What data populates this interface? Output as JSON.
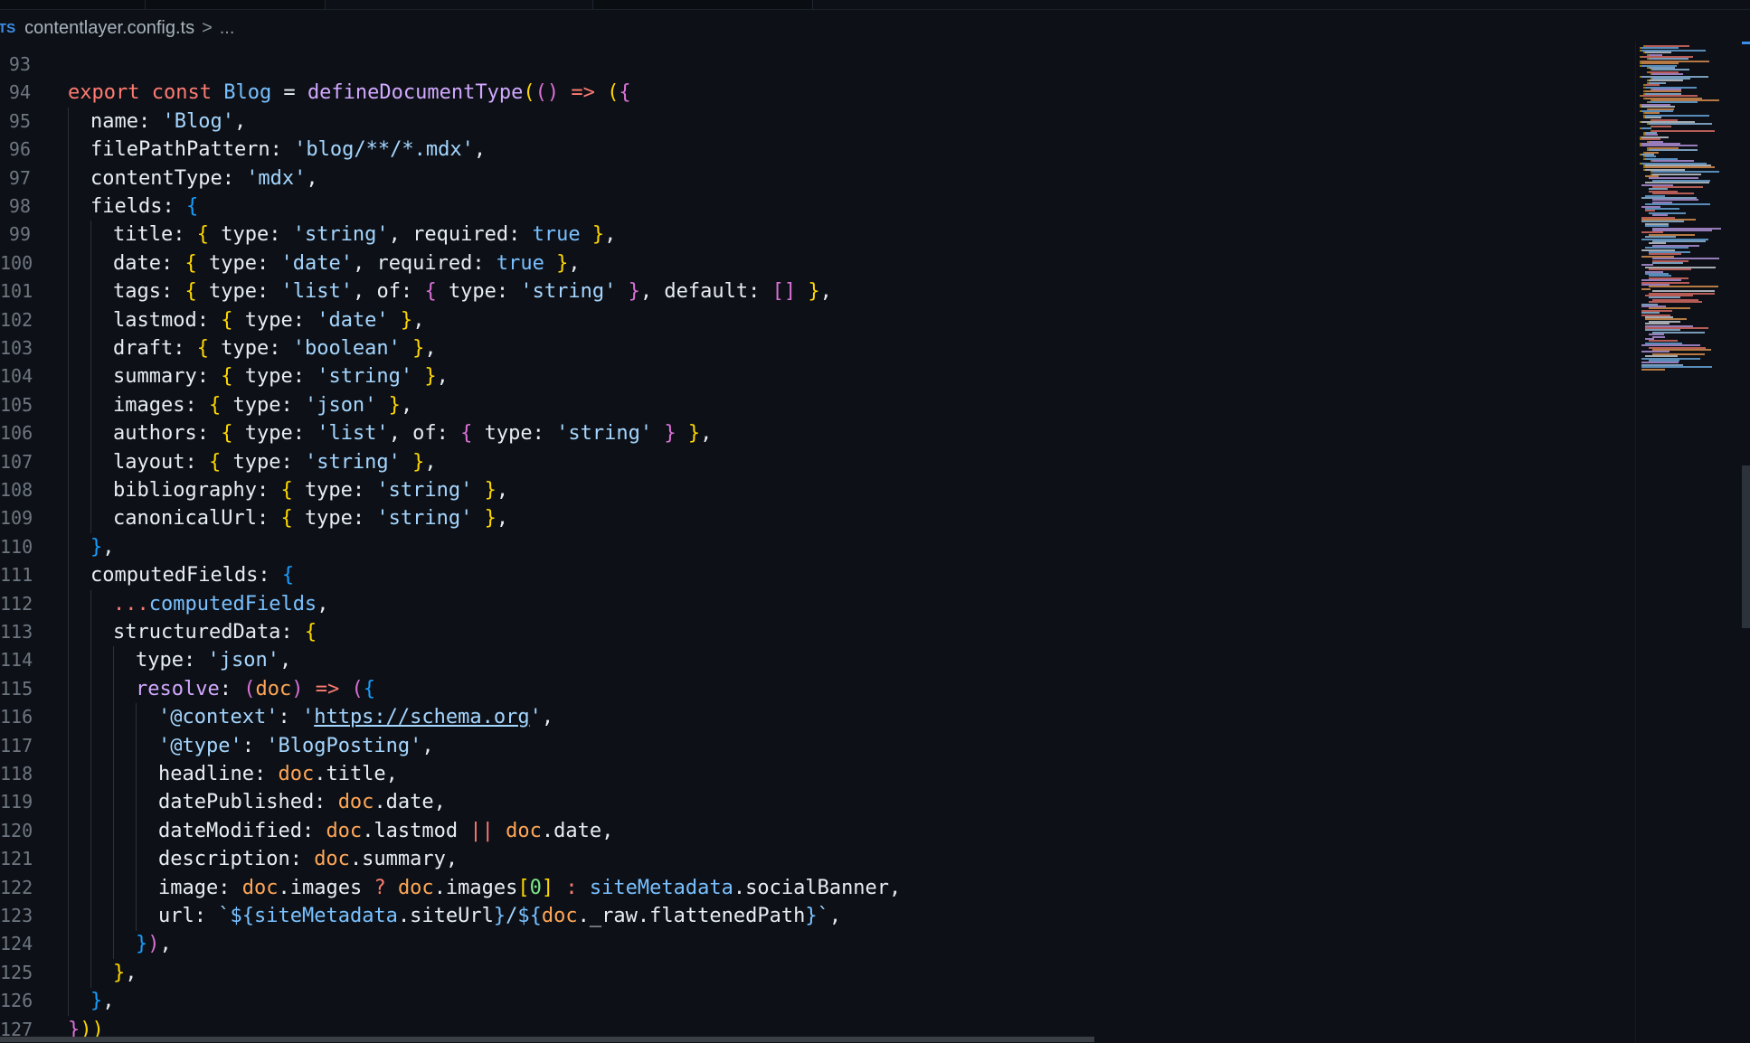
{
  "breadcrumb": {
    "lang_badge": "TS",
    "file": "contentlayer.config.ts",
    "separator": ">",
    "ellipsis": "..."
  },
  "editor": {
    "lines": [
      {
        "n": "93",
        "indent": 0,
        "tokens": []
      },
      {
        "n": "94",
        "indent": 0,
        "tokens": [
          [
            "kw",
            "export "
          ],
          [
            "kw",
            "const "
          ],
          [
            "var",
            "Blog"
          ],
          [
            "pl",
            " = "
          ],
          [
            "fn",
            "defineDocumentType"
          ],
          [
            "p1",
            "("
          ],
          [
            "p2",
            "()"
          ],
          [
            "pl",
            " "
          ],
          [
            "op",
            "=>"
          ],
          [
            "pl",
            " "
          ],
          [
            "p1",
            "("
          ],
          [
            "p2",
            "{"
          ]
        ]
      },
      {
        "n": "95",
        "indent": 1,
        "tokens": [
          [
            "pl",
            "name: "
          ],
          [
            "str",
            "'Blog'"
          ],
          [
            "pl",
            ","
          ]
        ]
      },
      {
        "n": "96",
        "indent": 1,
        "tokens": [
          [
            "pl",
            "filePathPattern: "
          ],
          [
            "str",
            "'blog/**/*.mdx'"
          ],
          [
            "pl",
            ","
          ]
        ]
      },
      {
        "n": "97",
        "indent": 1,
        "tokens": [
          [
            "pl",
            "contentType: "
          ],
          [
            "str",
            "'mdx'"
          ],
          [
            "pl",
            ","
          ]
        ]
      },
      {
        "n": "98",
        "indent": 1,
        "tokens": [
          [
            "pl",
            "fields: "
          ],
          [
            "p3",
            "{"
          ]
        ]
      },
      {
        "n": "99",
        "indent": 2,
        "tokens": [
          [
            "pl",
            "title: "
          ],
          [
            "p1",
            "{ "
          ],
          [
            "pl",
            "type: "
          ],
          [
            "str",
            "'string'"
          ],
          [
            "pl",
            ", required: "
          ],
          [
            "var",
            "true"
          ],
          [
            "p1",
            " }"
          ],
          [
            "pl",
            ","
          ]
        ]
      },
      {
        "n": "100",
        "indent": 2,
        "tokens": [
          [
            "pl",
            "date: "
          ],
          [
            "p1",
            "{ "
          ],
          [
            "pl",
            "type: "
          ],
          [
            "str",
            "'date'"
          ],
          [
            "pl",
            ", required: "
          ],
          [
            "var",
            "true"
          ],
          [
            "p1",
            " }"
          ],
          [
            "pl",
            ","
          ]
        ]
      },
      {
        "n": "101",
        "indent": 2,
        "tokens": [
          [
            "pl",
            "tags: "
          ],
          [
            "p1",
            "{ "
          ],
          [
            "pl",
            "type: "
          ],
          [
            "str",
            "'list'"
          ],
          [
            "pl",
            ", of: "
          ],
          [
            "p2",
            "{ "
          ],
          [
            "pl",
            "type: "
          ],
          [
            "str",
            "'string'"
          ],
          [
            "p2",
            " }"
          ],
          [
            "pl",
            ", default: "
          ],
          [
            "p2",
            "[]"
          ],
          [
            "p1",
            " }"
          ],
          [
            "pl",
            ","
          ]
        ]
      },
      {
        "n": "102",
        "indent": 2,
        "tokens": [
          [
            "pl",
            "lastmod: "
          ],
          [
            "p1",
            "{ "
          ],
          [
            "pl",
            "type: "
          ],
          [
            "str",
            "'date'"
          ],
          [
            "p1",
            " }"
          ],
          [
            "pl",
            ","
          ]
        ]
      },
      {
        "n": "103",
        "indent": 2,
        "tokens": [
          [
            "pl",
            "draft: "
          ],
          [
            "p1",
            "{ "
          ],
          [
            "pl",
            "type: "
          ],
          [
            "str",
            "'boolean'"
          ],
          [
            "p1",
            " }"
          ],
          [
            "pl",
            ","
          ]
        ]
      },
      {
        "n": "104",
        "indent": 2,
        "tokens": [
          [
            "pl",
            "summary: "
          ],
          [
            "p1",
            "{ "
          ],
          [
            "pl",
            "type: "
          ],
          [
            "str",
            "'string'"
          ],
          [
            "p1",
            " }"
          ],
          [
            "pl",
            ","
          ]
        ]
      },
      {
        "n": "105",
        "indent": 2,
        "tokens": [
          [
            "pl",
            "images: "
          ],
          [
            "p1",
            "{ "
          ],
          [
            "pl",
            "type: "
          ],
          [
            "str",
            "'json'"
          ],
          [
            "p1",
            " }"
          ],
          [
            "pl",
            ","
          ]
        ]
      },
      {
        "n": "106",
        "indent": 2,
        "tokens": [
          [
            "pl",
            "authors: "
          ],
          [
            "p1",
            "{ "
          ],
          [
            "pl",
            "type: "
          ],
          [
            "str",
            "'list'"
          ],
          [
            "pl",
            ", of: "
          ],
          [
            "p2",
            "{ "
          ],
          [
            "pl",
            "type: "
          ],
          [
            "str",
            "'string'"
          ],
          [
            "p2",
            " }"
          ],
          [
            "p1",
            " }"
          ],
          [
            "pl",
            ","
          ]
        ]
      },
      {
        "n": "107",
        "indent": 2,
        "tokens": [
          [
            "pl",
            "layout: "
          ],
          [
            "p1",
            "{ "
          ],
          [
            "pl",
            "type: "
          ],
          [
            "str",
            "'string'"
          ],
          [
            "p1",
            " }"
          ],
          [
            "pl",
            ","
          ]
        ]
      },
      {
        "n": "108",
        "indent": 2,
        "tokens": [
          [
            "pl",
            "bibliography: "
          ],
          [
            "p1",
            "{ "
          ],
          [
            "pl",
            "type: "
          ],
          [
            "str",
            "'string'"
          ],
          [
            "p1",
            " }"
          ],
          [
            "pl",
            ","
          ]
        ]
      },
      {
        "n": "109",
        "indent": 2,
        "tokens": [
          [
            "pl",
            "canonicalUrl: "
          ],
          [
            "p1",
            "{ "
          ],
          [
            "pl",
            "type: "
          ],
          [
            "str",
            "'string'"
          ],
          [
            "p1",
            " }"
          ],
          [
            "pl",
            ","
          ]
        ]
      },
      {
        "n": "110",
        "indent": 1,
        "tokens": [
          [
            "p3",
            "}"
          ],
          [
            "pl",
            ","
          ]
        ]
      },
      {
        "n": "111",
        "indent": 1,
        "tokens": [
          [
            "pl",
            "computedFields: "
          ],
          [
            "p3",
            "{"
          ]
        ]
      },
      {
        "n": "112",
        "indent": 2,
        "tokens": [
          [
            "op",
            "..."
          ],
          [
            "var",
            "computedFields"
          ],
          [
            "pl",
            ","
          ]
        ]
      },
      {
        "n": "113",
        "indent": 2,
        "tokens": [
          [
            "pl",
            "structuredData: "
          ],
          [
            "p1",
            "{"
          ]
        ]
      },
      {
        "n": "114",
        "indent": 3,
        "tokens": [
          [
            "pl",
            "type: "
          ],
          [
            "str",
            "'json'"
          ],
          [
            "pl",
            ","
          ]
        ]
      },
      {
        "n": "115",
        "indent": 3,
        "tokens": [
          [
            "fn",
            "resolve"
          ],
          [
            "pl",
            ": "
          ],
          [
            "p2",
            "("
          ],
          [
            "param",
            "doc"
          ],
          [
            "p2",
            ")"
          ],
          [
            "pl",
            " "
          ],
          [
            "op",
            "=>"
          ],
          [
            "pl",
            " "
          ],
          [
            "p2",
            "("
          ],
          [
            "p3",
            "{"
          ]
        ]
      },
      {
        "n": "116",
        "indent": 4,
        "tokens": [
          [
            "str",
            "'@context'"
          ],
          [
            "pl",
            ": "
          ],
          [
            "str",
            "'"
          ],
          [
            "str link",
            "https://schema.org"
          ],
          [
            "str",
            "'"
          ],
          [
            "pl",
            ","
          ]
        ]
      },
      {
        "n": "117",
        "indent": 4,
        "tokens": [
          [
            "str",
            "'@type'"
          ],
          [
            "pl",
            ": "
          ],
          [
            "str",
            "'BlogPosting'"
          ],
          [
            "pl",
            ","
          ]
        ]
      },
      {
        "n": "118",
        "indent": 4,
        "tokens": [
          [
            "pl",
            "headline: "
          ],
          [
            "param",
            "doc"
          ],
          [
            "pl",
            ".title,"
          ]
        ]
      },
      {
        "n": "119",
        "indent": 4,
        "tokens": [
          [
            "pl",
            "datePublished: "
          ],
          [
            "param",
            "doc"
          ],
          [
            "pl",
            ".date,"
          ]
        ]
      },
      {
        "n": "120",
        "indent": 4,
        "tokens": [
          [
            "pl",
            "dateModified: "
          ],
          [
            "param",
            "doc"
          ],
          [
            "pl",
            ".lastmod "
          ],
          [
            "op",
            "||"
          ],
          [
            "pl",
            " "
          ],
          [
            "param",
            "doc"
          ],
          [
            "pl",
            ".date,"
          ]
        ]
      },
      {
        "n": "121",
        "indent": 4,
        "tokens": [
          [
            "pl",
            "description: "
          ],
          [
            "param",
            "doc"
          ],
          [
            "pl",
            ".summary,"
          ]
        ]
      },
      {
        "n": "122",
        "indent": 4,
        "tokens": [
          [
            "pl",
            "image: "
          ],
          [
            "param",
            "doc"
          ],
          [
            "pl",
            ".images "
          ],
          [
            "op",
            "?"
          ],
          [
            "pl",
            " "
          ],
          [
            "param",
            "doc"
          ],
          [
            "pl",
            ".images"
          ],
          [
            "p1",
            "["
          ],
          [
            "num",
            "0"
          ],
          [
            "p1",
            "]"
          ],
          [
            "pl",
            " "
          ],
          [
            "op",
            ":"
          ],
          [
            "pl",
            " "
          ],
          [
            "var",
            "siteMetadata"
          ],
          [
            "pl",
            ".socialBanner,"
          ]
        ]
      },
      {
        "n": "123",
        "indent": 4,
        "tokens": [
          [
            "pl",
            "url: "
          ],
          [
            "str",
            "`"
          ],
          [
            "var",
            "${"
          ],
          [
            "var",
            "siteMetadata"
          ],
          [
            "pl",
            ".siteUrl"
          ],
          [
            "var",
            "}"
          ],
          [
            "str",
            "/"
          ],
          [
            "var",
            "${"
          ],
          [
            "param",
            "doc"
          ],
          [
            "pl",
            "._raw.flattenedPath"
          ],
          [
            "var",
            "}"
          ],
          [
            "str",
            "`"
          ],
          [
            "pl",
            ","
          ]
        ]
      },
      {
        "n": "124",
        "indent": 3,
        "tokens": [
          [
            "p3",
            "}"
          ],
          [
            "p2",
            ")"
          ],
          [
            "pl",
            ","
          ]
        ]
      },
      {
        "n": "125",
        "indent": 2,
        "tokens": [
          [
            "p1",
            "}"
          ],
          [
            "pl",
            ","
          ]
        ]
      },
      {
        "n": "126",
        "indent": 1,
        "tokens": [
          [
            "p3",
            "}"
          ],
          [
            "pl",
            ","
          ]
        ]
      },
      {
        "n": "127",
        "indent": 0,
        "tokens": [
          [
            "p2",
            "}"
          ],
          [
            "p1",
            "))"
          ]
        ]
      }
    ]
  }
}
